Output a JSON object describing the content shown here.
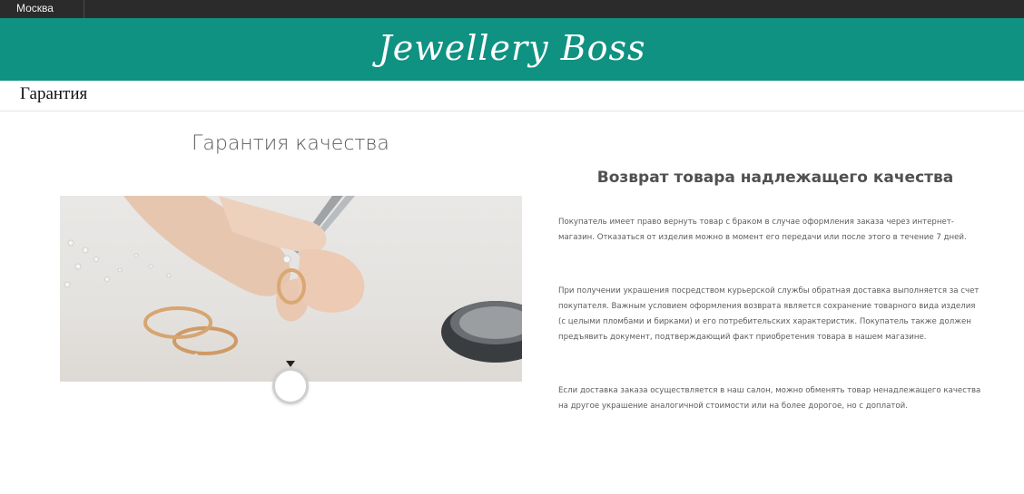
{
  "topbar": {
    "city": "Москва"
  },
  "header": {
    "logo": "Jewellery Boss"
  },
  "breadcrumb": {
    "current": "Гарантия"
  },
  "main": {
    "title": "Гарантия качества",
    "return_title": "Возврат товара надлежащего качества",
    "paragraphs": [
      "Покупатель имеет право вернуть товар с браком в случае оформления заказа через интернет-магазин. Отказаться от изделия можно в момент его передачи или после этого в течение 7 дней.",
      "При получении украшения посредством курьерской службы обратная доставка выполняется за счет покупателя. Важным условием оформления возврата является сохранение товарного вида изделия (с целыми пломбами и бирками) и его потребительских характеристик. Покупатель также должен предъявить документ, подтверждающий факт приобретения товара в нашем магазине.",
      "Если доставка заказа осуществляется в наш салон, можно обменять товар ненадлежащего качества на другое украшение аналогичной стоимости или на более дорогое, но с доплатой."
    ]
  },
  "colors": {
    "brand": "#0f9282",
    "topbar": "#2b2b2b"
  }
}
